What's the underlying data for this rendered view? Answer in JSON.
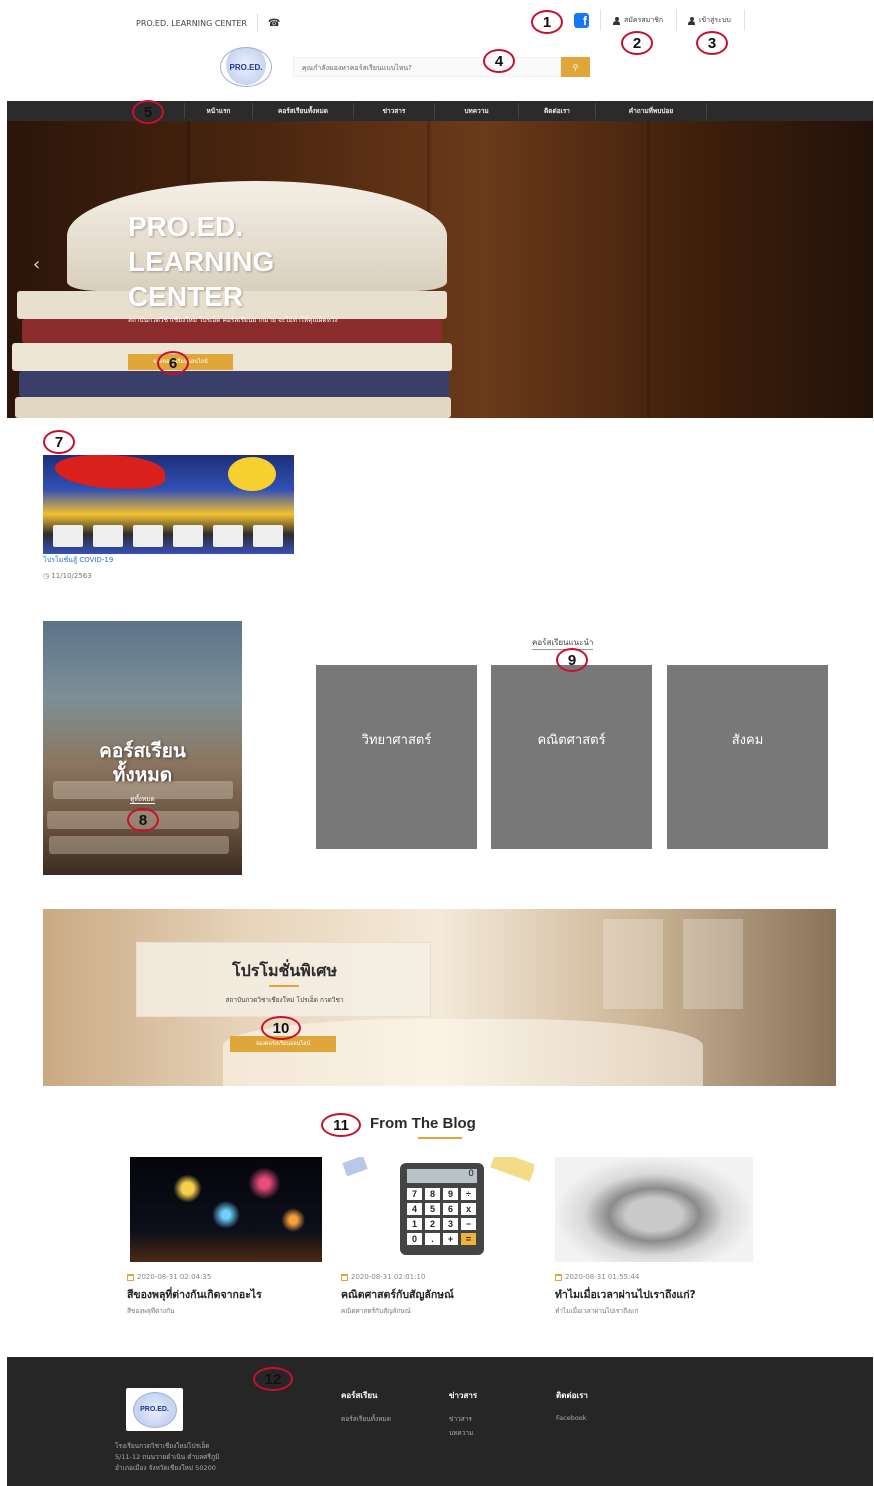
{
  "topbar": {
    "brand": "PRO.ED. LEARNING CENTER",
    "register": "สมัครสมาชิก",
    "login": "เข้าสู่ระบบ"
  },
  "search": {
    "placeholder": "คุณกำลังมองหาคอร์สเรียนแบบไหน?"
  },
  "logo_text": "PRO.ED.",
  "nav": [
    "หน้าแรก",
    "คอร์สเรียนทั้งหมด",
    "ข่าวสาร",
    "บทความ",
    "ติดต่อเรา",
    "คำถามที่พบบ่อย"
  ],
  "hero": {
    "title_lines": [
      "PRO.ED.",
      "LEARNING",
      "CENTER"
    ],
    "subtitle": "สถาบันกวดวิชาเชียงใหม่ โปรเอ็ด คอร์สเรียนมากมาย จะไม่ทำให้คุณผิดหวัง",
    "button": "จองคอร์สเรียนออนไลน์"
  },
  "promo": {
    "title": "โปรโมชั่นสู้ COVID-19",
    "date": "11/10/2563"
  },
  "all_courses": {
    "title_line1": "คอร์สเรียน",
    "title_line2": "ทั้งหมด",
    "link": "ดูทั้งหมด"
  },
  "recommended": {
    "title": "คอร์สเรียนแนะนำ",
    "tiles": [
      "วิทยาศาสตร์",
      "คณิตศาสตร์",
      "สังคม"
    ]
  },
  "special": {
    "title": "โปรโมชั่นพิเศษ",
    "subtitle": "สถาบันกวดวิชาเชียงใหม่ โปรเอ็ด กวดวิชา",
    "button": "จองคอร์สเรียนออนไลน์"
  },
  "blog": {
    "heading": "From The Blog",
    "posts": [
      {
        "date": "2020-08-31 02:04:35",
        "title": "สีของพลุที่ต่างกันเกิดจากอะไร",
        "desc": "สีของพลุที่ต่างกัน"
      },
      {
        "date": "2020-08-31 02:01:10",
        "title": "คณิตศาสตร์กับสัญลักษณ์",
        "desc": "คณิตศาสตร์กับสัญลักษณ์"
      },
      {
        "date": "2020-08-31 01:55:44",
        "title": "ทำไมเมื่อเวลาผ่านไปเราถึงแก่?",
        "desc": "ทำไมเมื่อเวลาผ่านไปเราถึงแก่"
      }
    ]
  },
  "calculator": {
    "screen": "0",
    "keys": [
      "7",
      "8",
      "9",
      "÷",
      "4",
      "5",
      "6",
      "x",
      "1",
      "2",
      "3",
      "−",
      "0",
      ".",
      "+",
      "="
    ]
  },
  "footer": {
    "address_lines": [
      "โรงเรียนกวดวิชาเชียงใหม่โปรเอ็ด",
      "5/11-12 ถนนวายดำเนิน ตำบลศรีภูมิ",
      "อำเภอเมือง จังหวัดเชียงใหม่ 50200"
    ],
    "col1_head": "คอร์สเรียน",
    "col1_links": [
      "คอร์สเรียนทั้งหมด"
    ],
    "col2_head": "ข่าวสาร",
    "col2_links": [
      "ข่าวสาร",
      "บทความ"
    ],
    "col3_head": "ติดต่อเรา",
    "col3_links": [
      "Facebook"
    ]
  },
  "annotations": [
    "1",
    "2",
    "3",
    "4",
    "5",
    "6",
    "7",
    "8",
    "9",
    "10",
    "11",
    "12"
  ],
  "colors": {
    "accent": "#e0a63a",
    "nav_bg": "#2b2b2b",
    "footer_bg": "#262626",
    "tile_bg": "#787878",
    "annotation": "#c8102e",
    "facebook": "#1877f2"
  }
}
